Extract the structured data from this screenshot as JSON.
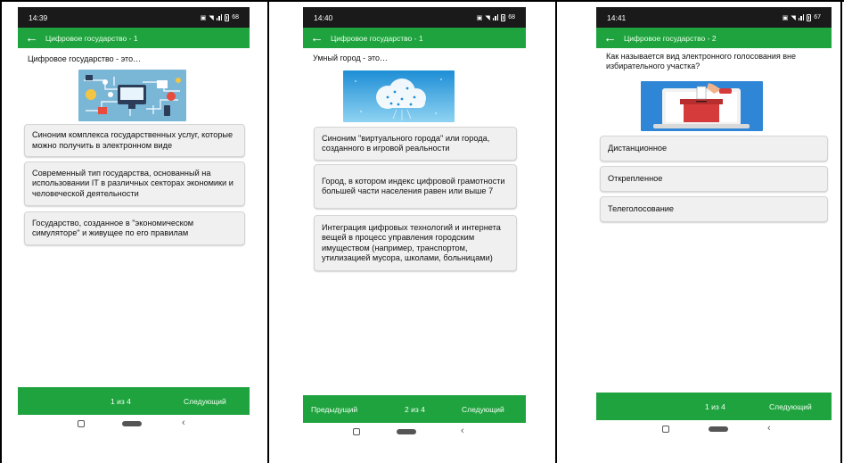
{
  "screens": [
    {
      "status_time": "14:39",
      "status_battery": "68",
      "app_title": "Цифровое государство - 1",
      "question": "Цифровое государство - это…",
      "options": [
        "Синоним комплекса государственных услуг, которые можно получить в электронном виде",
        "Современный тип государства, основанный на использовании IT в различных секторах экономики и человеческой деятельности",
        "Государство, созданное в \"экономическом симуляторе\" и живущее по его правилам"
      ],
      "nav": {
        "prev": "",
        "page": "1 из 4",
        "next": "Следующий"
      }
    },
    {
      "status_time": "14:40",
      "status_battery": "68",
      "app_title": "Цифровое государство - 1",
      "question": "Умный город - это…",
      "options": [
        "Синоним \"виртуального города\" или города, созданного в игровой реальности",
        "Город, в котором индекс цифровой грамотности большей части населения равен или выше 7",
        "Интеграция цифровых технологий и интернета вещей в процесс управления городским имуществом (например, транспортом, утилизацией мусора, школами, больницами)"
      ],
      "nav": {
        "prev": "Предыдущий",
        "page": "2 из 4",
        "next": "Следующий"
      }
    },
    {
      "status_time": "14:41",
      "status_battery": "67",
      "app_title": "Цифровое государство - 2",
      "question": "Как называется вид электронного голосования вне избирательного участка?",
      "options": [
        "Дистанционное",
        "Открепленное",
        "Телеголосование"
      ],
      "nav": {
        "prev": "",
        "page": "1 из 4",
        "next": "Следующий"
      }
    }
  ],
  "colors": {
    "app_green": "#1fa33f",
    "status_bg": "#1a1a1a"
  },
  "icons": {
    "back": "arrow-left-icon",
    "nav_recents": "square-icon",
    "nav_home": "pill-icon",
    "nav_back": "chevron-left-icon"
  }
}
